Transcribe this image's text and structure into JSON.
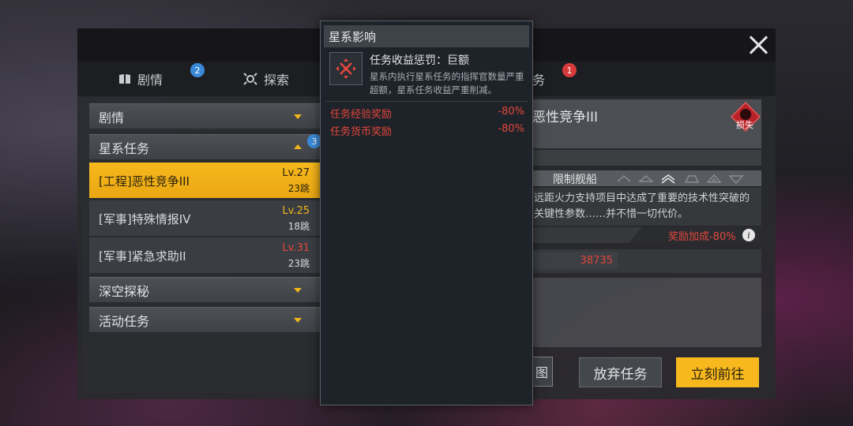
{
  "tabs": [
    {
      "label": "剧情",
      "icon": "book-icon",
      "badge": "2"
    },
    {
      "label": "探索",
      "icon": "explore-icon",
      "badge": null
    },
    {
      "label": "务",
      "icon": null,
      "badge": "1"
    }
  ],
  "categories": {
    "story": "剧情",
    "galaxy": "星系任务",
    "galaxy_badge": "3",
    "deep_space": "深空探秘",
    "event": "活动任务"
  },
  "quests": [
    {
      "name": "[工程]恶性竞争III",
      "level": "Lv.27",
      "jumps": "23跳",
      "selected": true,
      "level_color": "#2b2310"
    },
    {
      "name": "[军事]特殊情报IV",
      "level": "Lv.25",
      "jumps": "18跳",
      "selected": false,
      "level_color": "#f1b51c"
    },
    {
      "name": "[军事]紧急求助II",
      "level": "Lv.31",
      "jumps": "23跳",
      "selected": false,
      "level_color": "#e3473c"
    }
  ],
  "detail": {
    "title_fragment": "恶性竞争III",
    "loss_badge": "损失",
    "restricted_label": "限制舰船",
    "description": "远距火力支持项目中达成了重要的技术性突破的关键性参数……并不惜一切代价。",
    "bonus_label": "奖励加成",
    "bonus_value": "-80%",
    "reward_value": "38735",
    "map_button_fragment": "图",
    "abandon_button": "放弃任务",
    "goto_button": "立刻前往"
  },
  "tooltip": {
    "header": "星系影响",
    "effect_title": "任务收益惩罚：巨额",
    "effect_desc": "星系内执行星系任务的指挥官数量严重超额，星系任务收益严重削减。",
    "rows": [
      {
        "label": "任务经验奖励",
        "value": "-80%"
      },
      {
        "label": "任务货币奖励",
        "value": "-80%"
      }
    ]
  },
  "colors": {
    "accent_yellow": "#f6b81d",
    "penalty_red": "#e3473c",
    "badge_blue": "#3a8ad8",
    "badge_red": "#d83a3a"
  }
}
